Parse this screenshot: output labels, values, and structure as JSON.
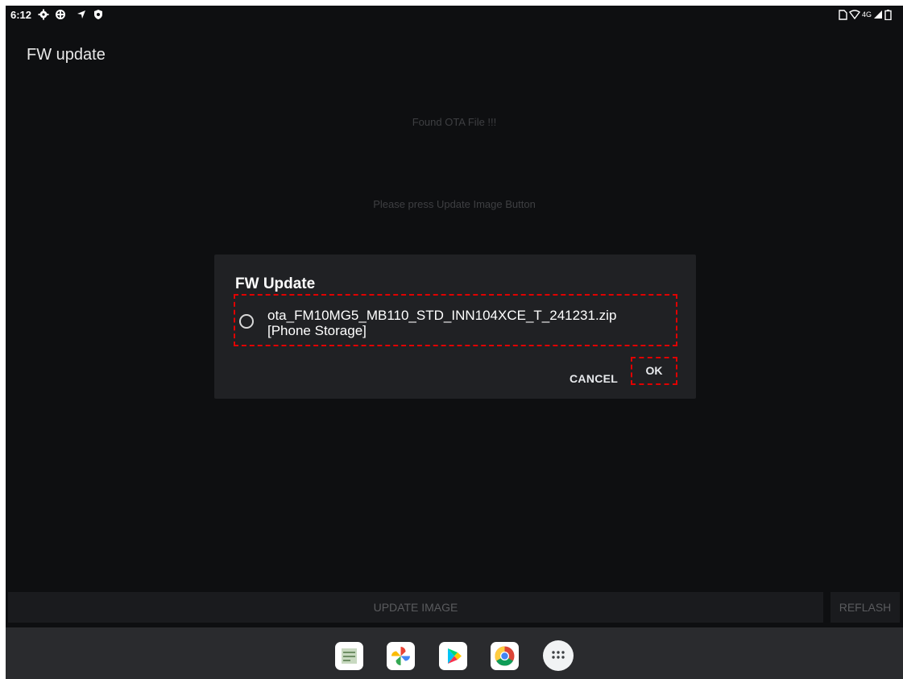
{
  "status_bar": {
    "time": "6:12",
    "network": "4G",
    "icons_left": [
      "settings-icon",
      "debug-gear-icon",
      "location-icon",
      "shield-icon"
    ],
    "icons_right": [
      "sim-icon",
      "wifi-icon",
      "signal-icon",
      "battery-icon"
    ]
  },
  "app": {
    "title": "FW update",
    "message_found": "Found OTA File !!!",
    "message_instruction": "Please press Update Image Button",
    "update_button": "UPDATE IMAGE",
    "reflash_button": "REFLASH"
  },
  "dialog": {
    "title": "FW Update",
    "file_name": "ota_FM10MG5_MB110_STD_INN104XCE_T_241231.zip",
    "file_location": "[Phone Storage]",
    "cancel_label": "CANCEL",
    "ok_label": "OK",
    "highlight_color": "#e00000"
  },
  "dock": {
    "apps": [
      "sheets-icon",
      "google-photos-icon",
      "play-store-icon",
      "chrome-icon",
      "app-drawer-icon"
    ]
  }
}
